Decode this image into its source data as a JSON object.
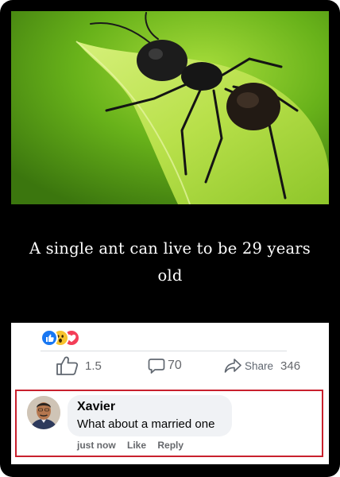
{
  "post": {
    "caption": "A single ant can live to be 29 years old"
  },
  "reactions": {
    "icons": [
      "like-icon",
      "wow-icon",
      "love-icon"
    ],
    "colors": {
      "like": "#1877f2",
      "wow": "#f7c32e",
      "love": "#f33e58"
    }
  },
  "actions": {
    "like_count": "1.5",
    "comment_count": "70",
    "share_label": "Share",
    "share_count": "346"
  },
  "comment": {
    "author": "Xavier",
    "text": "What about a married one",
    "time": "just now",
    "like_label": "Like",
    "reply_label": "Reply",
    "highlight_color": "#c8202d"
  }
}
